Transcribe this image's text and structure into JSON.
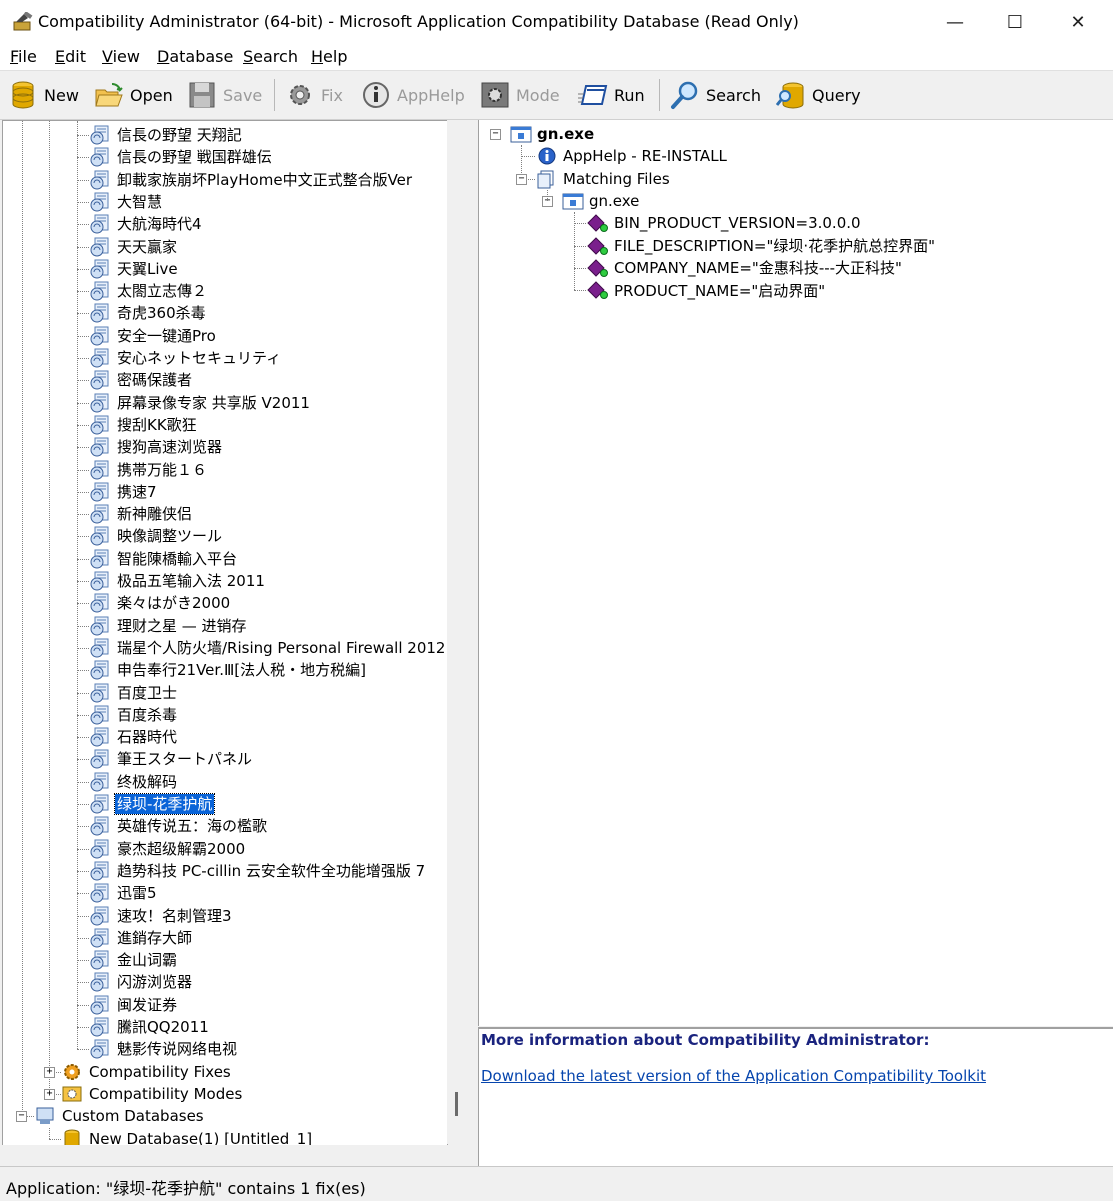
{
  "window": {
    "title": "Compatibility Administrator (64-bit) - Microsoft Application Compatibility Database (Read Only)",
    "minimize_glyph": "—",
    "maximize_glyph": "☐",
    "close_glyph": "✕"
  },
  "menu": [
    {
      "u": "F",
      "rest": "ile"
    },
    {
      "u": "E",
      "rest": "dit"
    },
    {
      "u": "V",
      "rest": "iew"
    },
    {
      "u": "D",
      "rest": "atabase"
    },
    {
      "u": "S",
      "rest": "earch"
    },
    {
      "u": "H",
      "rest": "elp"
    }
  ],
  "toolbar": {
    "new": "New",
    "open": "Open",
    "save": "Save",
    "fix": "Fix",
    "apphelp": "AppHelp",
    "mode": "Mode",
    "run": "Run",
    "search": "Search",
    "query": "Query"
  },
  "left_tree": {
    "apps": [
      "信長の野望 天翔記",
      "信長の野望 戦国群雄伝",
      "卸載家族崩坏PlayHome中文正式整合版Ver",
      "大智慧",
      "大航海時代4",
      "天天贏家",
      "天翼Live",
      "太閤立志傳２",
      "奇虎360杀毒",
      "安全一键通Pro",
      "安心ネットセキュリティ",
      "密碼保護者",
      "屏幕录像专家 共享版 V2011",
      "搜刮KK歌狂",
      "搜狗高速浏览器",
      "携帯万能１６",
      "携速7",
      "新神雕侠侣",
      "映像調整ツール",
      "智能陳橋輸入平台",
      "极品五笔输入法 2011",
      "楽々はがき2000",
      "理财之星 — 进销存",
      "瑞星个人防火墙/Rising Personal Firewall 2012",
      "申告奉行21Ver.Ⅲ[法人税・地方税編]",
      "百度卫士",
      "百度杀毒",
      "石器時代",
      "筆王スタートパネル",
      "终极解码",
      "绿坝-花季护航",
      "英雄传说五：海の檻歌",
      "豪杰超级解霸2000",
      "趋势科技 PC-cillin 云安全软件全功能增强版 7",
      "迅雷5",
      "速攻！名刺管理3",
      "進銷存大師",
      "金山词霸",
      "闪游浏览器",
      "闽发证券",
      "騰訊QQ2011",
      "魅影传说网络电视"
    ],
    "selected_index": 30,
    "compat_fixes": "Compatibility Fixes",
    "compat_modes": "Compatibility Modes",
    "custom_databases": "Custom Databases",
    "new_database": "New Database(1) [Untitled_1]",
    "expand_glyph": "+",
    "collapse_glyph": "−"
  },
  "right_tree": {
    "root": "gn.exe",
    "apphelp": "AppHelp - RE-INSTALL",
    "matching_files": "Matching Files",
    "file": "gn.exe",
    "attributes": [
      "BIN_PRODUCT_VERSION=3.0.0.0",
      "FILE_DESCRIPTION=\"绿坝·花季护航总控界面\"",
      "COMPANY_NAME=\"金惠科技---大正科技\"",
      "PRODUCT_NAME=\"启动界面\""
    ]
  },
  "info": {
    "title": "More information about Compatibility Administrator:",
    "link": "Download the latest version of the Application Compatibility Toolkit"
  },
  "status": {
    "text": "Application: \"绿坝-花季护航\" contains 1 fix(es)"
  }
}
